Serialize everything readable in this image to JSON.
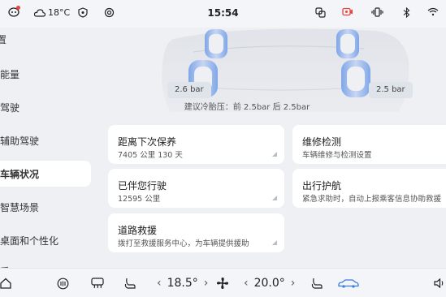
{
  "status_bar": {
    "temperature": "18°C",
    "time": "15:54",
    "icons": [
      "profile-icon",
      "cloud-icon",
      "shield-icon",
      "sync-icon",
      "screen-mirror-icon",
      "camera-record-icon",
      "vibrate-icon",
      "bluetooth-icon",
      "wifi-icon"
    ],
    "accent_color": "#e8453c"
  },
  "sidebar": {
    "items": [
      {
        "label": "置"
      },
      {
        "label": "能量"
      },
      {
        "label": "驾驶"
      },
      {
        "label": "辅助驾驶"
      },
      {
        "label": "车辆状况",
        "active": true
      },
      {
        "label": "智慧场景"
      },
      {
        "label": "桌面和个性化"
      },
      {
        "label": "系"
      }
    ]
  },
  "tire": {
    "front_left": "2.6 bar",
    "front_right": "2.5 bar",
    "hint": "建议冷胎压：前 2.5bar  后 2.5bar"
  },
  "cards": {
    "maintenance": {
      "title": "距离下次保养",
      "sub": "7405 公里 130 天"
    },
    "repair": {
      "title": "维修检测",
      "sub": "车辆维修与检测设置"
    },
    "companion": {
      "title": "已伴您行驶",
      "sub": "12595 公里"
    },
    "escort": {
      "title": "出行护航",
      "sub": "紧急求助时，自动上报乘客信息协助救援"
    },
    "rescue": {
      "title": "道路救援",
      "sub": "拨打至救援服务中心，为车辆提供援助"
    }
  },
  "bottom_bar": {
    "driver_temp": "18.5°",
    "passenger_temp": "20.0°",
    "icons": [
      "home-icon",
      "ac-icon",
      "rear-defrost-icon",
      "seat-heat-icon",
      "fan-icon",
      "seat-icon",
      "car-icon",
      "volume-icon"
    ]
  }
}
